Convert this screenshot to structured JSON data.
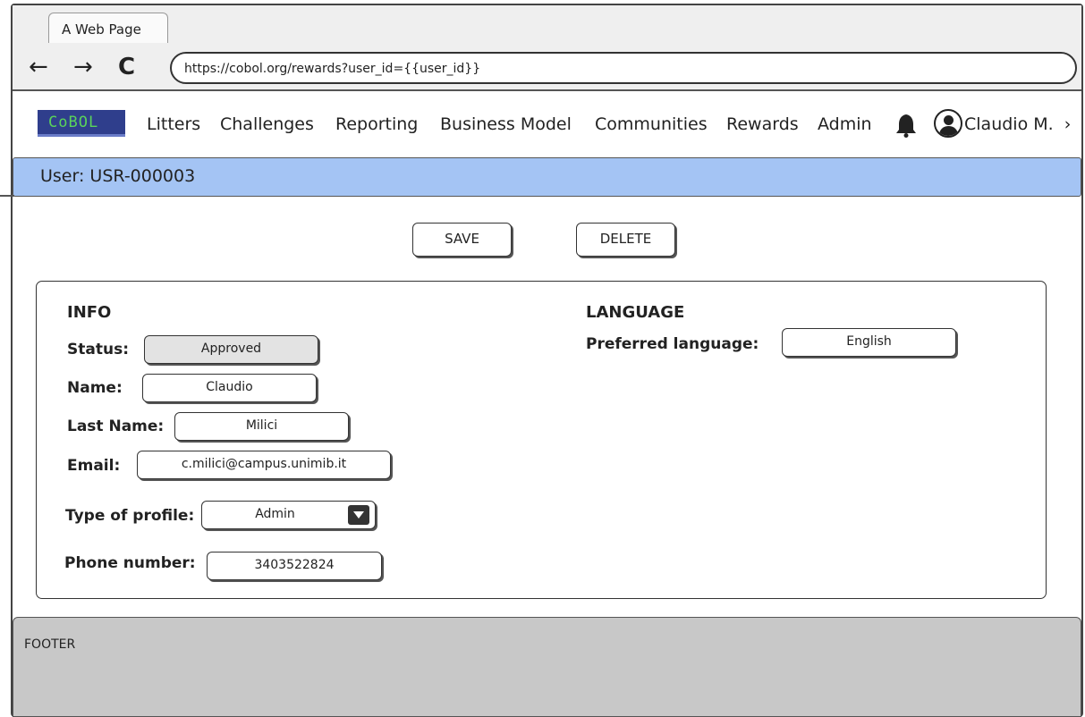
{
  "browser": {
    "tab_title": "A Web Page",
    "back_icon": "←",
    "forward_icon": "→",
    "reload_icon": "C",
    "url": "https://cobol.org/rewards?user_id={{user_id}}"
  },
  "app_nav": {
    "logo_text": "CoBOL",
    "items": [
      "Litters",
      "Challenges",
      "Reporting",
      "Business Model",
      "Communities",
      "Rewards",
      "Admin"
    ],
    "user_name": "Claudio M.",
    "chevron": "›"
  },
  "user_bar": {
    "title": "User: USR-000003"
  },
  "actions": {
    "save_label": "SAVE",
    "delete_label": "DELETE"
  },
  "info": {
    "title": "INFO",
    "status": {
      "label": "Status:",
      "value": "Approved"
    },
    "name": {
      "label": "Name:",
      "value": "Claudio"
    },
    "last_name": {
      "label": "Last Name:",
      "value": "Milici"
    },
    "email": {
      "label": "Email:",
      "value": "c.milici@campus.unimib.it"
    },
    "profile_type": {
      "label": "Type of profile:",
      "value": "Admin"
    },
    "phone": {
      "label": "Phone number:",
      "value": "3403522824"
    }
  },
  "language": {
    "title": "LANGUAGE",
    "preferred": {
      "label": "Preferred language:",
      "value": "English"
    }
  },
  "footer": {
    "text": "FOOTER"
  },
  "colors": {
    "user_bar": "#a4c4f4",
    "footer": "#c8c8c8",
    "logo_bg": "#2f3e8c",
    "logo_fg": "#5ad35a"
  }
}
